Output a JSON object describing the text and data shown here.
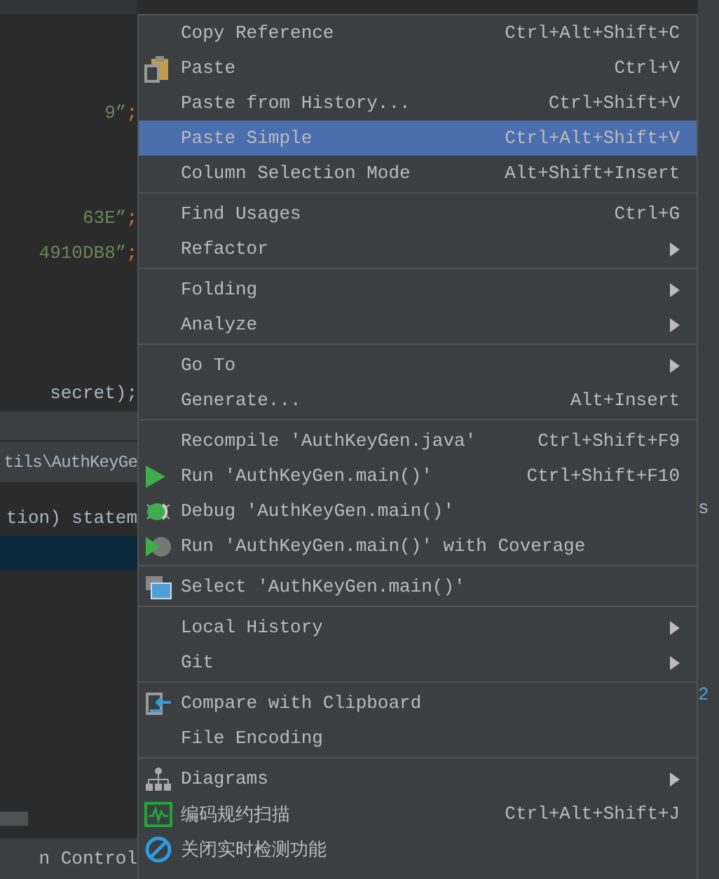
{
  "editor": {
    "lines": [
      {
        "kind": "code",
        "string": "9”",
        "punct": ";"
      },
      {
        "kind": "blank"
      },
      {
        "kind": "blank"
      },
      {
        "kind": "code",
        "string": "63E”",
        "punct": ";"
      },
      {
        "kind": "code",
        "string": "4910DB8”",
        "punct": ";"
      },
      {
        "kind": "blank"
      },
      {
        "kind": "blank"
      },
      {
        "kind": "blank"
      },
      {
        "kind": "code",
        "plain": " secret);"
      }
    ]
  },
  "run_panel": {
    "path": "tils\\AuthKeyGe",
    "lines": [
      {
        "text": "tion) statem",
        "selected": false
      },
      {
        "selected": true
      }
    ],
    "status_tab": "n Control"
  },
  "right_strip": {
    "dropdown": "s",
    "count": "2"
  },
  "menu": {
    "groups": [
      [
        {
          "label": "Copy Reference",
          "shortcut": "Ctrl+Alt+Shift+C",
          "selected": false
        },
        {
          "label": "Paste",
          "shortcut": "Ctrl+V",
          "kind": "paste",
          "selected": false
        },
        {
          "label": "Paste from History...",
          "shortcut": "Ctrl+Shift+V",
          "selected": false
        },
        {
          "label": "Paste Simple",
          "shortcut": "Ctrl+Alt+Shift+V",
          "selected": true
        },
        {
          "label": "Column Selection Mode",
          "shortcut": "Alt+Shift+Insert",
          "selected": false
        }
      ],
      [
        {
          "label": "Find Usages",
          "shortcut": "Ctrl+G",
          "selected": false
        },
        {
          "label": "Refactor",
          "submenu": true,
          "selected": false
        }
      ],
      [
        {
          "label": "Folding",
          "submenu": true,
          "selected": false
        },
        {
          "label": "Analyze",
          "submenu": true,
          "selected": false
        }
      ],
      [
        {
          "label": "Go To",
          "submenu": true,
          "selected": false
        },
        {
          "label": "Generate...",
          "shortcut": "Alt+Insert",
          "selected": false
        }
      ],
      [
        {
          "label": "Recompile 'AuthKeyGen.java'",
          "shortcut": "Ctrl+Shift+F9",
          "selected": false
        },
        {
          "label": "Run 'AuthKeyGen.main()'",
          "shortcut": "Ctrl+Shift+F10",
          "kind": "run",
          "selected": false
        },
        {
          "label": "Debug 'AuthKeyGen.main()'",
          "kind": "debug",
          "selected": false
        },
        {
          "label": "Run 'AuthKeyGen.main()' with Coverage",
          "kind": "coverage",
          "selected": false
        }
      ],
      [
        {
          "label": "Select 'AuthKeyGen.main()'",
          "kind": "select",
          "selected": false
        }
      ],
      [
        {
          "label": "Local History",
          "submenu": true,
          "selected": false
        },
        {
          "label": "Git",
          "submenu": true,
          "selected": false
        }
      ],
      [
        {
          "label": "Compare with Clipboard",
          "kind": "compare",
          "selected": false
        },
        {
          "label": "File Encoding",
          "selected": false
        }
      ],
      [
        {
          "label": "Diagrams",
          "submenu": true,
          "kind": "diagram",
          "selected": false
        },
        {
          "label": "编码规约扫描",
          "shortcut": "Ctrl+Alt+Shift+J",
          "kind": "scan",
          "selected": false
        },
        {
          "label": "关闭实时检测功能",
          "kind": "block",
          "selected": false
        }
      ]
    ]
  }
}
